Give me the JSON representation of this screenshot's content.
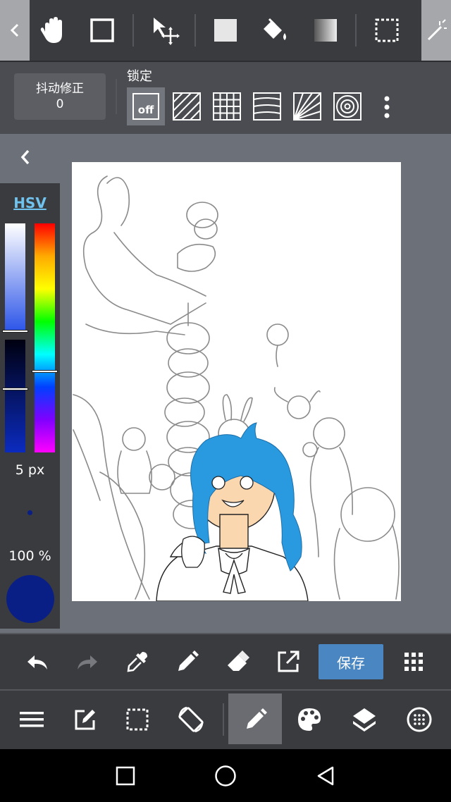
{
  "top_toolbar": {
    "tools": [
      "hand-icon",
      "rectangle-icon",
      "move-icon",
      "fill-square-icon",
      "paint-bucket-icon",
      "gradient-icon",
      "selection-icon"
    ]
  },
  "stabilizer": {
    "label": "抖动修正",
    "value": "0"
  },
  "lock": {
    "label": "锁定",
    "off_label": "off"
  },
  "color_panel": {
    "mode_label": "HSV",
    "brush_size": "5 px",
    "opacity": "100 %",
    "current_color": "#0a1f86"
  },
  "bottom_toolbar": {
    "save_label": "保存"
  },
  "colors": {
    "accent": "#4a86c2",
    "hair": "#2a9ae0",
    "skin": "#fbd7b0"
  }
}
